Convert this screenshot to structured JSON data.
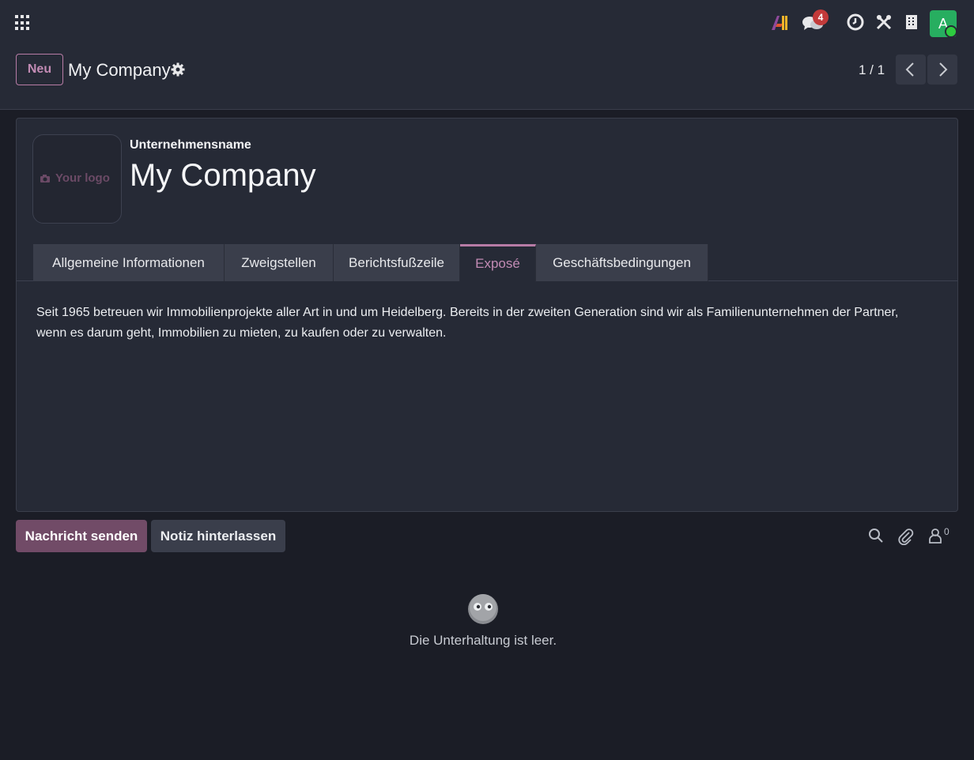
{
  "navbar": {
    "badge_count": "4",
    "user_initial": "A"
  },
  "control_panel": {
    "new_button": "Neu",
    "breadcrumb": "My Company",
    "pager": "1 / 1"
  },
  "form": {
    "logo_placeholder": "Your logo",
    "name_label": "Unternehmensname",
    "name_value": "My Company",
    "tabs": [
      {
        "label": "Allgemeine Informationen",
        "active": false
      },
      {
        "label": "Zweigstellen",
        "active": false
      },
      {
        "label": "Berichtsfußzeile",
        "active": false
      },
      {
        "label": "Exposé",
        "active": true
      },
      {
        "label": "Geschäftsbedingungen",
        "active": false
      }
    ],
    "expose_text": "Seit 1965 betreuen wir Immobilienprojekte aller Art in und um Heidelberg. Bereits in der zweiten Generation sind wir als Familienunternehmen der Partner, wenn es darum geht, Immobilien zu mieten, zu kaufen oder zu verwalten."
  },
  "chatter": {
    "send_button": "Nachricht senden",
    "note_button": "Notiz hinterlassen",
    "follower_count": "0",
    "empty_text": "Die Unterhaltung ist leer."
  },
  "colors": {
    "background": "#1b1d26",
    "panel": "#262a36",
    "accent": "#714b67",
    "accent_light": "#c28bb4",
    "badge": "#c23a3a",
    "avatar": "#27ae60"
  }
}
